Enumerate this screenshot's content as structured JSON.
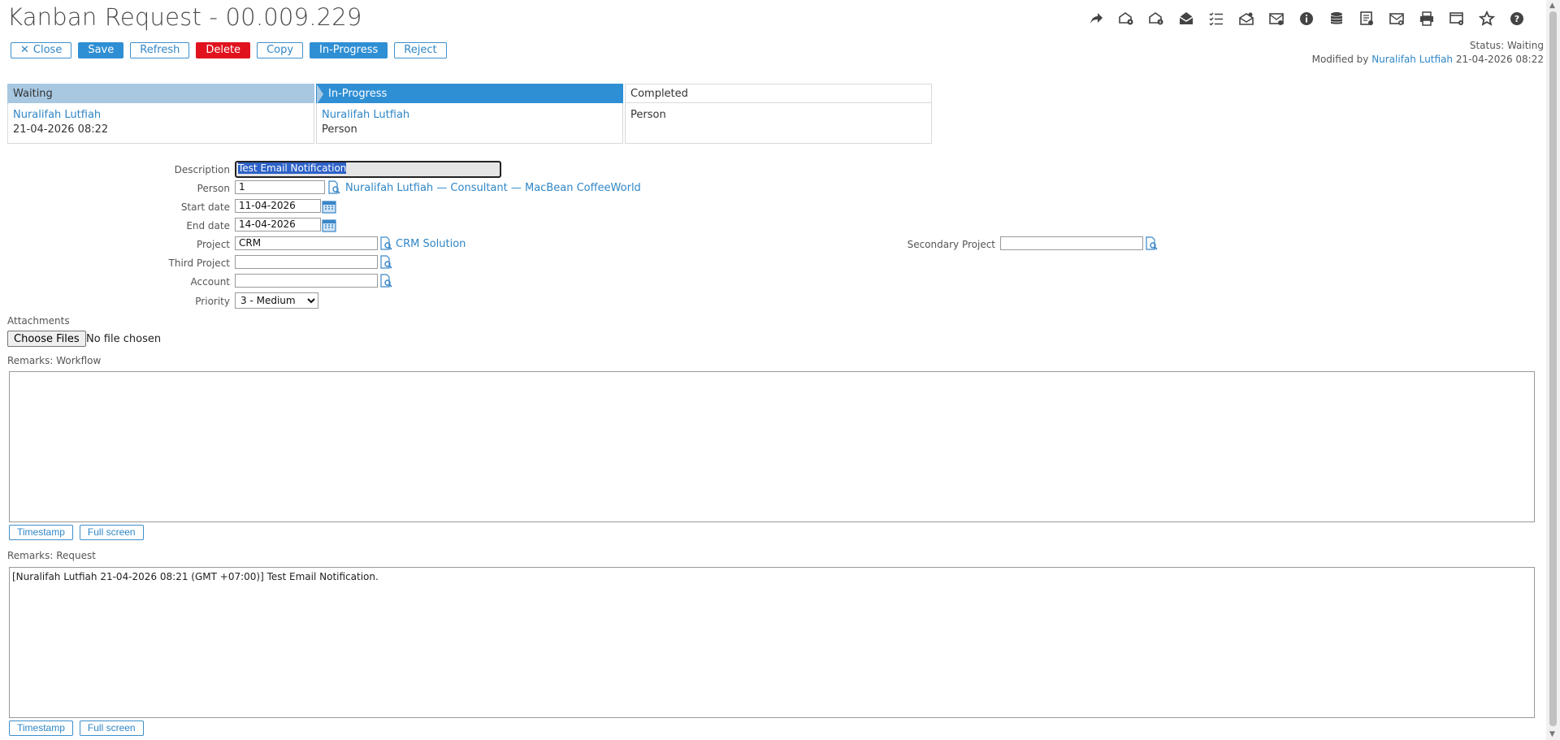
{
  "title": "Kanban Request - 00.009.229",
  "toolbar": {
    "close": "Close",
    "save": "Save",
    "refresh": "Refresh",
    "delete": "Delete",
    "copy": "Copy",
    "in_progress": "In-Progress",
    "reject": "Reject"
  },
  "top_icons": [
    "share-icon",
    "mail-settings-icon",
    "mail-info-icon",
    "open-envelope-icon",
    "checklist-icon",
    "mail-open-icon",
    "mail-box-icon",
    "info-icon",
    "database-icon",
    "document-list-icon",
    "mail-close-icon",
    "print-icon",
    "document-settings-icon",
    "star-icon",
    "help-icon"
  ],
  "status": {
    "label": "Status: Waiting",
    "modified_prefix": "Modified by",
    "modified_by": "Nuralifah Lutfiah",
    "modified_at": "21-04-2026 08:22"
  },
  "workflow": [
    {
      "name": "Waiting",
      "person": "Nuralifah Lutfiah",
      "detail": "21-04-2026 08:22"
    },
    {
      "name": "In-Progress",
      "person": "Nuralifah Lutfiah",
      "detail": "Person"
    },
    {
      "name": "Completed",
      "person": "",
      "detail": "Person"
    }
  ],
  "form": {
    "description_label": "Description",
    "description_value": "Test Email Notification",
    "person_label": "Person",
    "person_value": "1",
    "person_link": "Nuralifah Lutfiah — Consultant — MacBean CoffeeWorld",
    "start_label": "Start date",
    "start_value": "11-04-2026",
    "end_label": "End date",
    "end_value": "14-04-2026",
    "project_label": "Project",
    "project_value": "CRM",
    "project_link": "CRM Solution",
    "secondary_label": "Secondary Project",
    "secondary_value": "",
    "third_label": "Third Project",
    "third_value": "",
    "account_label": "Account",
    "account_value": "",
    "priority_label": "Priority",
    "priority_value": "3 - Medium"
  },
  "attachments": {
    "label": "Attachments",
    "button": "Choose Files",
    "status": "No file chosen"
  },
  "remarks_workflow": {
    "label": "Remarks: Workflow",
    "value": "",
    "timestamp": "Timestamp",
    "fullscreen": "Full screen"
  },
  "remarks_request": {
    "label": "Remarks: Request",
    "value": "[Nuralifah Lutfiah 21-04-2026 08:21 (GMT +07:00)] Test Email Notification.",
    "timestamp": "Timestamp",
    "fullscreen": "Full screen"
  }
}
